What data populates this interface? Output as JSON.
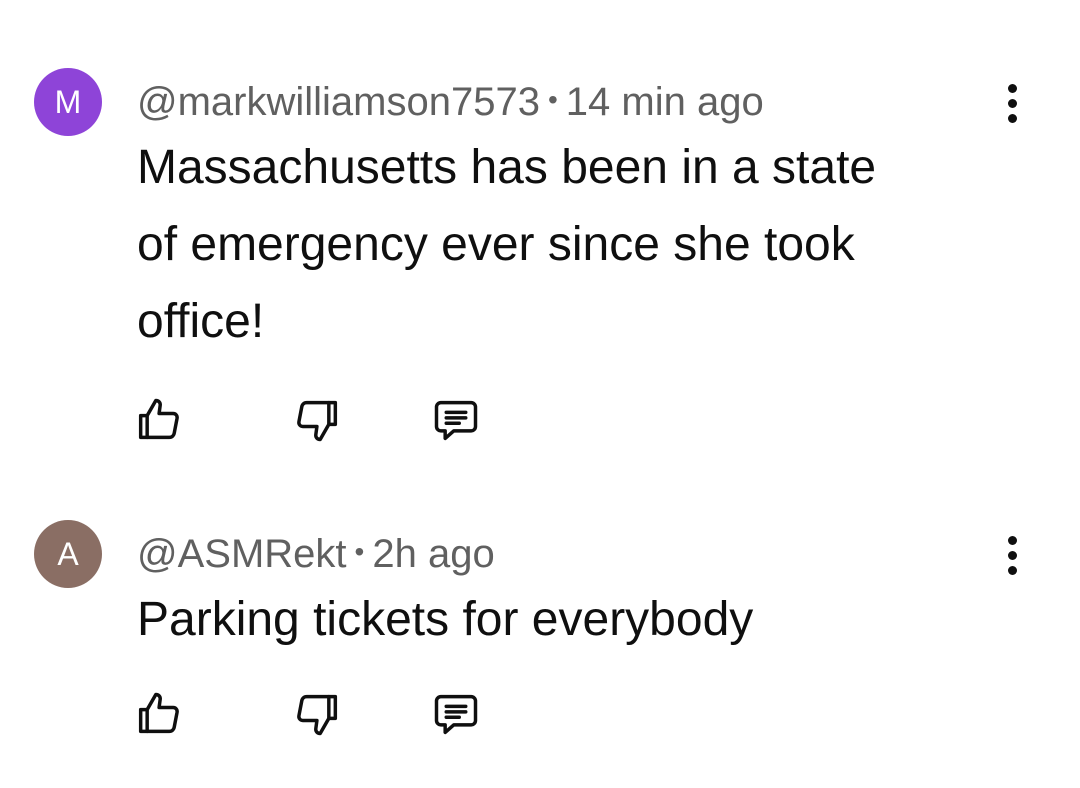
{
  "comments": [
    {
      "avatar_letter": "M",
      "avatar_color": "#8e44d8",
      "username": "@markwilliamson7573",
      "separator": "•",
      "time": "14 min ago",
      "text_lines": [
        "Massachusetts has been in a state",
        "of emergency ever since she took",
        "office!"
      ],
      "actions": {
        "like_icon": "thumbs-up-icon",
        "dislike_icon": "thumbs-down-icon",
        "reply_icon": "reply-comment-icon"
      }
    },
    {
      "avatar_letter": "A",
      "avatar_color": "#8a6e64",
      "username": "@ASMRekt",
      "separator": "•",
      "time": "2h ago",
      "text_lines": [
        "Parking tickets for everybody"
      ],
      "actions": {
        "like_icon": "thumbs-up-icon",
        "dislike_icon": "thumbs-down-icon",
        "reply_icon": "reply-comment-icon"
      }
    }
  ]
}
